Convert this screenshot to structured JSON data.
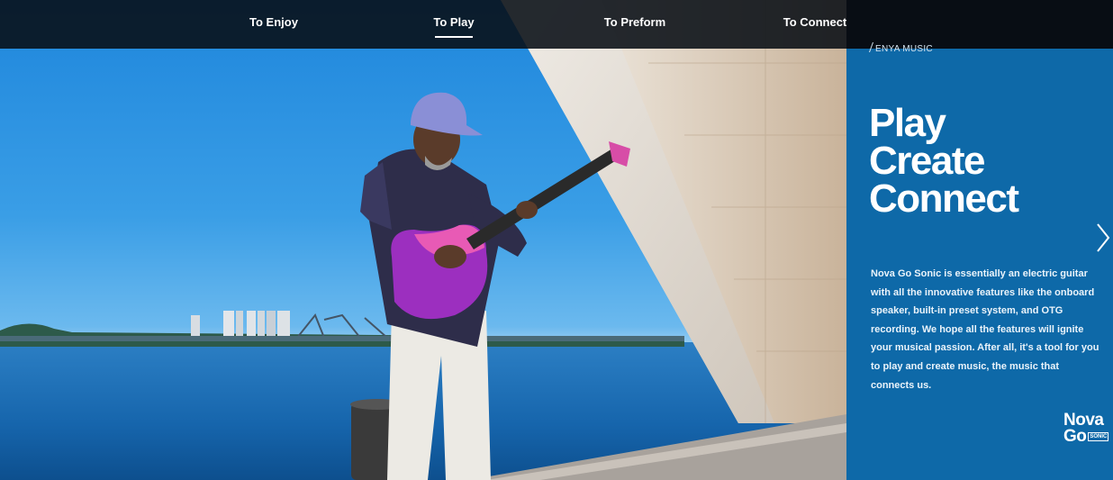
{
  "nav": {
    "items": [
      {
        "label": "To Enjoy",
        "active": false
      },
      {
        "label": "To Play",
        "active": true
      },
      {
        "label": "To Preform",
        "active": false
      },
      {
        "label": "To Connect",
        "active": false
      }
    ]
  },
  "panel": {
    "brand": "ENYA MUSIC",
    "headline": [
      "Play",
      "Create",
      "Connect"
    ],
    "description": "Nova Go Sonic is essentially an electric guitar with all the innovative features like the onboard speaker, built-in preset system, and OTG recording. We hope all the features will ignite your musical passion. After all, it's a tool for you to play and create music, the music that connects us.",
    "logo": {
      "line1": "Nova",
      "line2": "Go",
      "badge": "SONIC"
    },
    "next_icon": "chevron-right-icon"
  },
  "colors": {
    "panel_bg": "#0e69a8",
    "nav_bg": "#080e14",
    "accent_text": "#ffffff"
  }
}
